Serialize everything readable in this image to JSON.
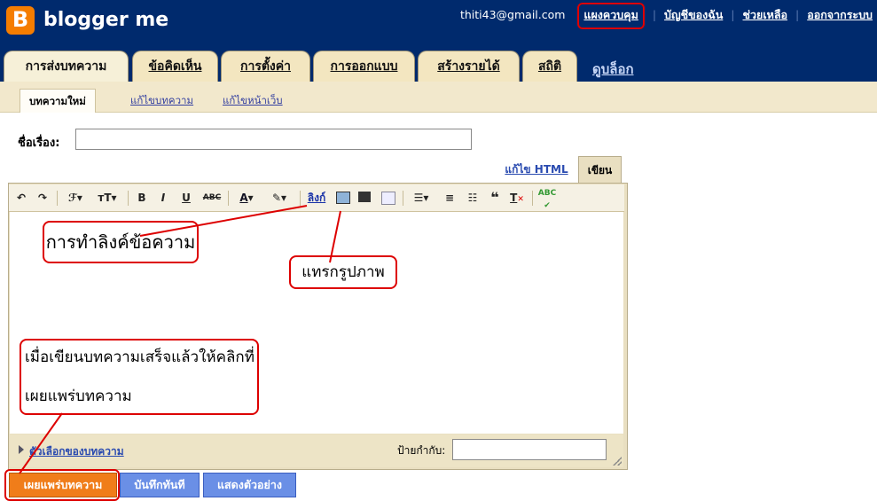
{
  "app": {
    "brand": "blogger me",
    "logo_letter": "B"
  },
  "topnav": {
    "email": "thiti43@gmail.com",
    "links": [
      "แผงควบคุม",
      "บัญชีของฉัน",
      "ช่วยเหลือ",
      "ออกจากระบบ"
    ]
  },
  "tabs": [
    {
      "label": "การส่งบทความ",
      "active": true
    },
    {
      "label": "ข้อคิดเห็น"
    },
    {
      "label": "การตั้งค่า"
    },
    {
      "label": "การออกแบบ"
    },
    {
      "label": "สร้างรายได้"
    },
    {
      "label": "สถิติ"
    }
  ],
  "blog_link": "ดูบล็อก",
  "subtabs": [
    "บทความใหม่",
    "แก้ไขบทความ",
    "แก้ไขหน้าเว็บ"
  ],
  "post": {
    "title_label": "ชื่อเรื่อง:",
    "title_value": ""
  },
  "mode_tabs": {
    "html": "แก้ไข HTML",
    "compose": "เขียน"
  },
  "toolbar": {
    "font": "ℱ",
    "size": "тT",
    "bold": "B",
    "italic": "I",
    "underline": "U",
    "strike": "ABC",
    "color": "A",
    "link": "ลิงก์",
    "spell": "ABC"
  },
  "annotations": {
    "link_note": "การทำลิงค์ข้อความ",
    "image_note": "แทรกรูปภาพ",
    "publish_note_line1": "เมื่อเขียนบทความเสร็จแล้วให้คลิกที่",
    "publish_note_line2": "เผยแพร่บทความ"
  },
  "footer": {
    "options_link": "ตัวเลือกของบทความ",
    "labels_label": "ป้ายกำกับ:",
    "labels_value": ""
  },
  "buttons": {
    "publish": "เผยแพร่บทความ",
    "save": "บันทึกทันที",
    "preview": "แสดงตัวอย่าง"
  },
  "colors": {
    "header_bg": "#002a6d",
    "tab_bg": "#f3e6c0",
    "publish": "#f07d1a",
    "annotation": "#dd0000"
  }
}
